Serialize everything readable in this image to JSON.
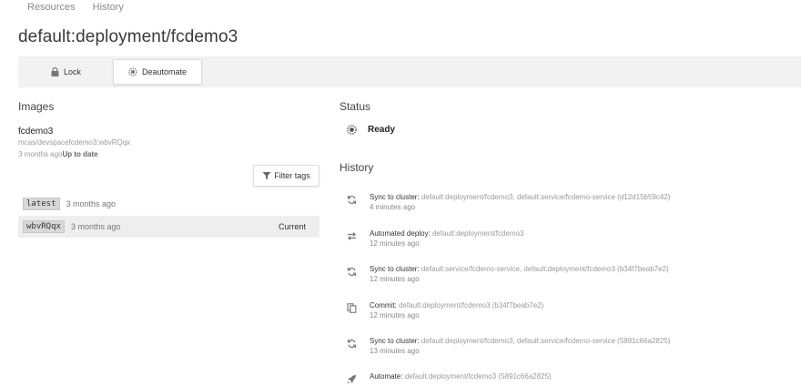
{
  "nav": {
    "items": [
      "Resources",
      "History"
    ]
  },
  "page": {
    "title": "default:deployment/fcdemo3"
  },
  "toolbar": {
    "lock_label": "Lock",
    "deautomate_label": "Deautomate"
  },
  "images": {
    "heading": "Images",
    "name": "fcdemo3",
    "path": "mcas/devspacefcdemo3:wbvRQqx",
    "date": "3 months ago",
    "date_status": "Up to date",
    "filter_label": "Filter tags",
    "tags": [
      {
        "tag": "latest",
        "age": "3 months ago",
        "current": ""
      },
      {
        "tag": "wbvRQqx",
        "age": "3 months ago",
        "current": "Current"
      }
    ]
  },
  "status": {
    "heading": "Status",
    "value": "Ready"
  },
  "history": {
    "heading": "History",
    "items": [
      {
        "icon": "sync-icon",
        "action": "Sync to cluster:",
        "refs": "default:deployment/fcdemo3, default:service/fcdemo-service",
        "hash": "(d12d15b59c42)",
        "time": "4 minutes ago"
      },
      {
        "icon": "arrows-exchange-icon",
        "action": "Automated deploy:",
        "refs": "default:deployment/fcdemo3",
        "hash": "",
        "time": "12 minutes ago"
      },
      {
        "icon": "sync-icon",
        "action": "Sync to cluster:",
        "refs": "default:service/fcdemo-service, default:deployment/fcdemo3",
        "hash": "(b34f7beab7e2)",
        "time": "12 minutes ago"
      },
      {
        "icon": "copy-icon",
        "action": "Commit:",
        "refs": "default:deployment/fcdemo3",
        "hash": "(b34f7beab7e2)",
        "time": "12 minutes ago"
      },
      {
        "icon": "sync-icon",
        "action": "Sync to cluster:",
        "refs": "default:deployment/fcdemo3, default:service/fcdemo-service",
        "hash": "(5891c66a2825)",
        "time": "13 minutes ago"
      },
      {
        "icon": "rocket-icon",
        "action": "Automate:",
        "refs": "default:deployment/fcdemo3",
        "hash": "(5891c66a2825)",
        "time": ""
      }
    ]
  }
}
